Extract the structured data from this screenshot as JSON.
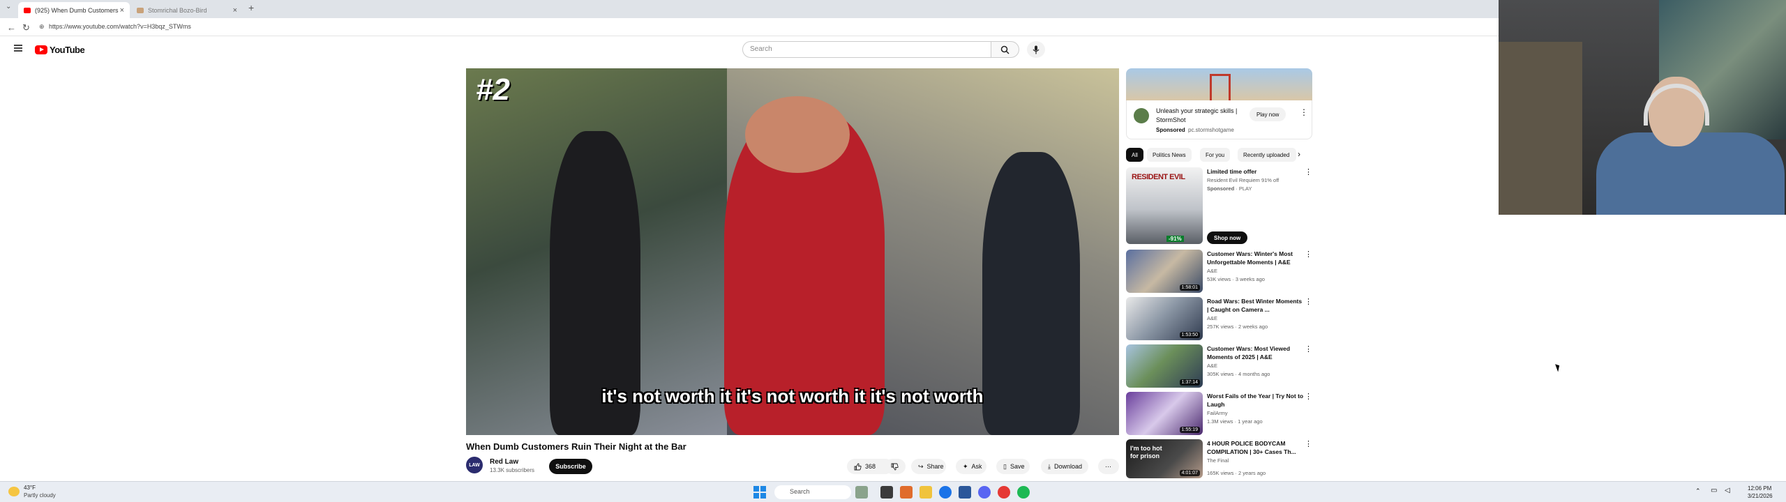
{
  "browser": {
    "tabs": [
      {
        "label": "(925) When Dumb Customers",
        "active": true
      },
      {
        "label": "Stomrichal Bozo-Bird",
        "active": false
      }
    ],
    "url": "https://www.youtube.com/watch?v=H3bqz_STWms"
  },
  "header": {
    "logo_text": "YouTube",
    "search_placeholder": "Search"
  },
  "video": {
    "overlay_rank": "#2",
    "caption": "it's not worth it it's not worth it it's not worth",
    "title": "When Dumb Customers Ruin Their Night at the Bar",
    "channel": {
      "avatar_text": "LAW",
      "name": "Red Law",
      "subscribers": "13.3K subscribers"
    },
    "subscribe_label": "Subscribe",
    "actions": {
      "likes": "368",
      "share": "Share",
      "ask": "Ask",
      "save": "Save",
      "download": "Download"
    }
  },
  "sidebar": {
    "ad": {
      "title": "Unleash your strategic skills | StormShot",
      "sponsored": "Sponsored",
      "domain": "pc.stormshotgame",
      "cta": "Play now"
    },
    "chips": [
      "All",
      "Politics News",
      "For you",
      "Recently uploaded"
    ],
    "promo": {
      "title": "Limited time offer",
      "subtitle": "Resident Evil Requiem 91% off",
      "sponsored": "Sponsored",
      "store": "PLAY",
      "thumb_text": "RESIDENT EVIL",
      "discount": "-91%",
      "cta": "Shop now"
    },
    "items": [
      {
        "title": "Customer Wars: Winter's Most Unforgettable Moments | A&E",
        "channel": "A&E",
        "meta": "53K views · 3 weeks ago",
        "duration": "1:58:01"
      },
      {
        "title": "Road Wars: Best Winter Moments | Caught on Camera ...",
        "channel": "A&E",
        "meta": "257K views · 2 weeks ago",
        "duration": "1:53:50"
      },
      {
        "title": "Customer Wars: Most Viewed Moments of 2025 | A&E",
        "channel": "A&E",
        "meta": "305K views · 4 months ago",
        "duration": "1:37:14"
      },
      {
        "title": "Worst Fails of the Year | Try Not to Laugh",
        "channel": "FailArmy",
        "meta": "1.3M views · 1 year ago",
        "duration": "1:55:19"
      },
      {
        "title": "4 HOUR POLICE BODYCAM COMPILATION | 30+ Cases Th...",
        "channel": "The Final",
        "meta": "165K views · 2 years ago",
        "duration": "4:01:07",
        "thumb_text": "I'm too hot for prison"
      }
    ]
  },
  "taskbar": {
    "weather_temp": "43°F",
    "weather_desc": "Partly cloudy",
    "search": "Search",
    "time": "12:06 PM",
    "date": "3/21/2026"
  }
}
